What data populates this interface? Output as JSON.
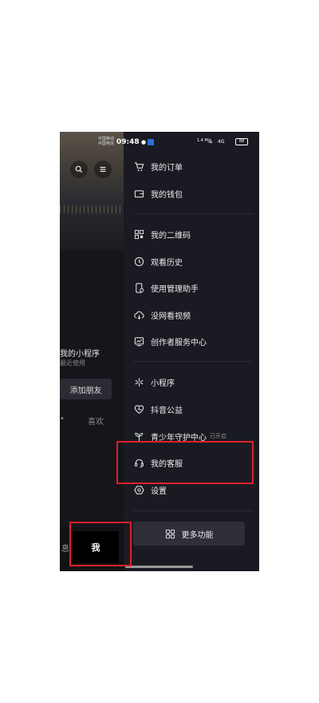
{
  "status_bar": {
    "carrier_1": "中国移动",
    "carrier_2": "中国电信",
    "time": "09:48",
    "speed": "1.4 M/s",
    "signal": "4G",
    "battery": "88"
  },
  "profile": {
    "mini_program_title": "我的小程序",
    "mini_program_sub": "最近使用",
    "add_friend": "添加朋友",
    "tab_left": "•",
    "tab_likes": "喜欢",
    "bottom_msg": "息",
    "bottom_me": "我"
  },
  "drawer": {
    "items": [
      {
        "label": "我的订单",
        "icon": "cart-icon"
      },
      {
        "label": "我的钱包",
        "icon": "wallet-icon"
      },
      {
        "label": "我的二维码",
        "icon": "qrcode-icon"
      },
      {
        "label": "观看历史",
        "icon": "clock-icon"
      },
      {
        "label": "使用管理助手",
        "icon": "phone-manage-icon"
      },
      {
        "label": "没网看视频",
        "icon": "cloud-download-icon"
      },
      {
        "label": "创作者服务中心",
        "icon": "creator-chart-icon"
      },
      {
        "label": "小程序",
        "icon": "mini-program-icon"
      },
      {
        "label": "抖音公益",
        "icon": "heart-charity-icon"
      },
      {
        "label": "青少年守护中心",
        "icon": "sprout-icon",
        "badge": "已开启"
      },
      {
        "label": "我的客服",
        "icon": "headset-icon"
      },
      {
        "label": "设置",
        "icon": "settings-hex-icon"
      }
    ],
    "more_label": "更多功能"
  },
  "colors": {
    "background": "#15151b",
    "drawer": "#1a1b22",
    "highlight": "#e0202a"
  }
}
